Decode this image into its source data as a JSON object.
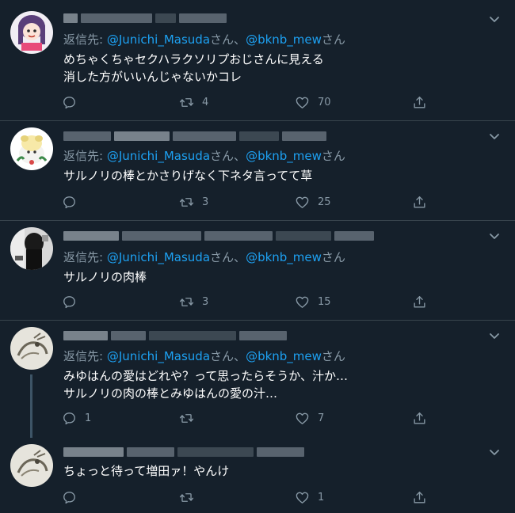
{
  "labels": {
    "reply_prefix": "返信先: ",
    "honorific": "さん",
    "separator": "、"
  },
  "colors": {
    "background": "#15202b",
    "text": "#ffffff",
    "muted": "#8899a6",
    "accent": "#1da1f2",
    "divider": "#38444d"
  },
  "tweets": [
    {
      "reply_to": [
        "@Junichi_Masuda",
        "@bknb_mew"
      ],
      "lines": [
        "めちゃくちゃセクハラクソリプおじさんに見える",
        "消した方がいいんじゃないかコレ"
      ],
      "replies": "",
      "retweets": "4",
      "likes": "70"
    },
    {
      "reply_to": [
        "@Junichi_Masuda",
        "@bknb_mew"
      ],
      "lines": [
        "サルノリの棒とかさりげなく下ネタ言ってて草"
      ],
      "replies": "",
      "retweets": "3",
      "likes": "25"
    },
    {
      "reply_to": [
        "@Junichi_Masuda",
        "@bknb_mew"
      ],
      "lines": [
        "サルノリの肉棒"
      ],
      "replies": "",
      "retweets": "3",
      "likes": "15"
    },
    {
      "reply_to": [
        "@Junichi_Masuda",
        "@bknb_mew"
      ],
      "lines": [
        "みゆはんの愛はどれや？って思ったらそうか、汁か…",
        "サルノリの肉の棒とみゆはんの愛の汁…"
      ],
      "replies": "1",
      "retweets": "",
      "likes": "7"
    },
    {
      "reply_to": [],
      "lines": [
        "ちょっと待って増田ァ！やんけ"
      ],
      "replies": "",
      "retweets": "",
      "likes": "1"
    }
  ],
  "icons": {
    "reply": "reply-icon",
    "retweet": "retweet-icon",
    "like": "heart-icon",
    "share": "share-icon",
    "menu": "chevron-down-icon"
  }
}
